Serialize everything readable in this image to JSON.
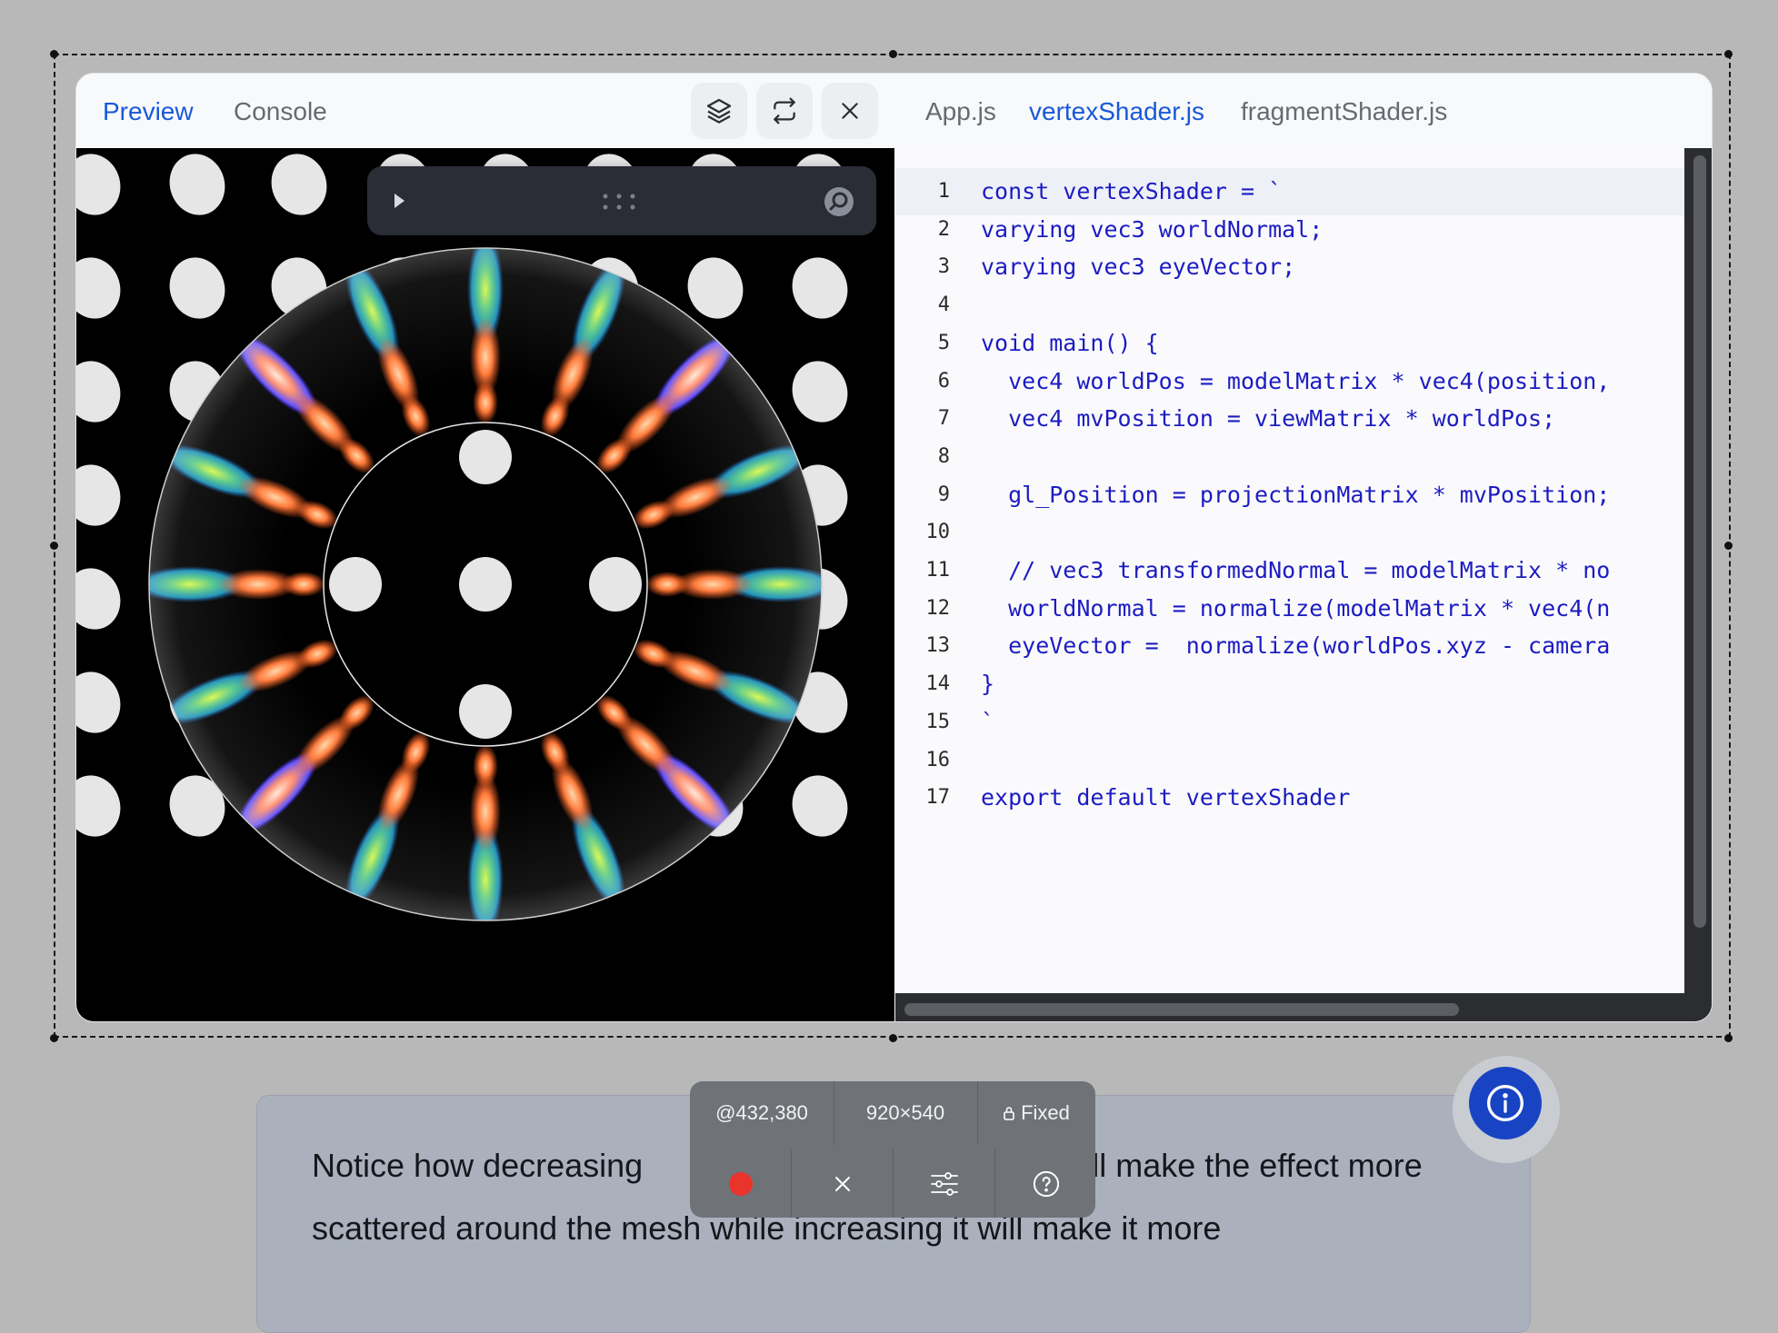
{
  "preview_tabs": [
    {
      "label": "Preview",
      "active": true
    },
    {
      "label": "Console",
      "active": false
    }
  ],
  "file_tabs": [
    {
      "label": "App.js",
      "active": false
    },
    {
      "label": "vertexShader.js",
      "active": true
    },
    {
      "label": "fragmentShader.js",
      "active": false
    }
  ],
  "toolbar_icons": [
    "layers-icon",
    "refresh-icon",
    "close-icon"
  ],
  "preview_toolbar_icons": [
    "play-icon",
    "drag-handle-icon",
    "inspect-icon"
  ],
  "code": {
    "line_numbers": [
      "1",
      "2",
      "3",
      "4",
      "5",
      "6",
      "7",
      "8",
      "9",
      "10",
      "11",
      "12",
      "13",
      "14",
      "15",
      "16",
      "17"
    ],
    "lines": [
      "const vertexShader = `",
      "varying vec3 worldNormal;",
      "varying vec3 eyeVector;",
      "",
      "void main() {",
      "  vec4 worldPos = modelMatrix * vec4(position,",
      "  vec4 mvPosition = viewMatrix * worldPos;",
      "",
      "  gl_Position = projectionMatrix * mvPosition;",
      "",
      "  // vec3 transformedNormal = modelMatrix * no",
      "  worldNormal = normalize(modelMatrix * vec4(n",
      "  eyeVector =  normalize(worldPos.xyz - camera",
      "}",
      "`",
      "",
      "export default vertexShader"
    ]
  },
  "hud": {
    "position": "@432,380",
    "size": "920×540",
    "mode": "Fixed",
    "record_color": "#e8342c"
  },
  "article": {
    "text_before": "Notice how decreasing ",
    "text_after": "n will make the effect more scattered around the mesh while increasing it will make it more"
  },
  "colors": {
    "accent": "#1859d8",
    "code_keyword": "#1c1cc2",
    "info_button": "#1844c4"
  }
}
